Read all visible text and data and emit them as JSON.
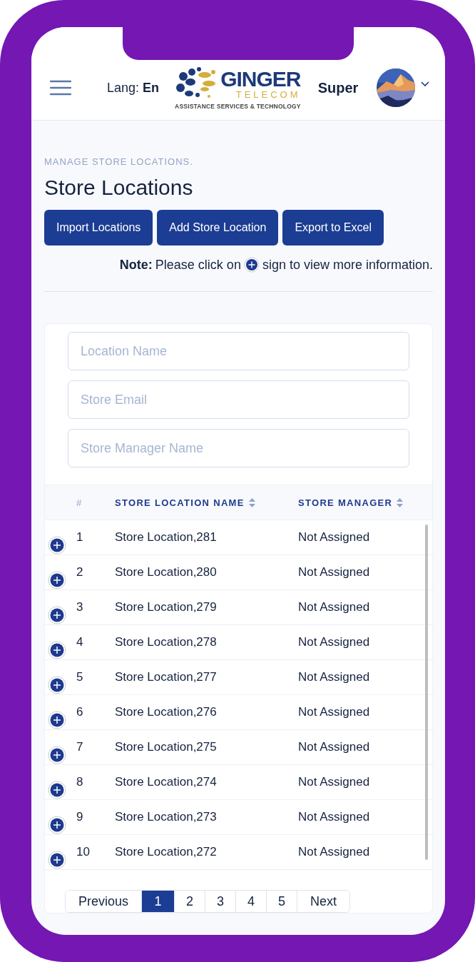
{
  "header": {
    "lang_label": "Lang:",
    "lang_value": "En",
    "logo": {
      "name": "GINGER",
      "sub": "TELECOM",
      "tagline": "ASSISTANCE SERVICES & TECHNOLOGY"
    },
    "user": "Super"
  },
  "page": {
    "eyebrow": "MANAGE STORE LOCATIONS.",
    "title": "Store Locations",
    "buttons": [
      "Import Locations",
      "Add Store Location",
      "Export to Excel"
    ],
    "note": {
      "label": "Note:",
      "before": "Please click on",
      "after": "sign to view more information."
    }
  },
  "filters": [
    {
      "placeholder": "Location Name"
    },
    {
      "placeholder": "Store Email"
    },
    {
      "placeholder": "Store Manager Name"
    }
  ],
  "table": {
    "columns": [
      {
        "label": "#",
        "sortable": false
      },
      {
        "label": "STORE LOCATION NAME",
        "sortable": true
      },
      {
        "label": "STORE MANAGER",
        "sortable": true
      }
    ],
    "rows": [
      {
        "index": "1",
        "name": "Store Location,281",
        "manager": "Not Assigned"
      },
      {
        "index": "2",
        "name": "Store Location,280",
        "manager": "Not Assigned"
      },
      {
        "index": "3",
        "name": "Store Location,279",
        "manager": "Not Assigned"
      },
      {
        "index": "4",
        "name": "Store Location,278",
        "manager": "Not Assigned"
      },
      {
        "index": "5",
        "name": "Store Location,277",
        "manager": "Not Assigned"
      },
      {
        "index": "6",
        "name": "Store Location,276",
        "manager": "Not Assigned"
      },
      {
        "index": "7",
        "name": "Store Location,275",
        "manager": "Not Assigned"
      },
      {
        "index": "8",
        "name": "Store Location,274",
        "manager": "Not Assigned"
      },
      {
        "index": "9",
        "name": "Store Location,273",
        "manager": "Not Assigned"
      },
      {
        "index": "10",
        "name": "Store Location,272",
        "manager": "Not Assigned"
      }
    ]
  },
  "pagination": {
    "previous": "Previous",
    "pages": [
      {
        "label": "1",
        "selected": true
      },
      {
        "label": "2",
        "selected": false
      },
      {
        "label": "3",
        "selected": false
      },
      {
        "label": "4",
        "selected": false
      },
      {
        "label": "5",
        "selected": false
      }
    ],
    "next": "Next"
  }
}
